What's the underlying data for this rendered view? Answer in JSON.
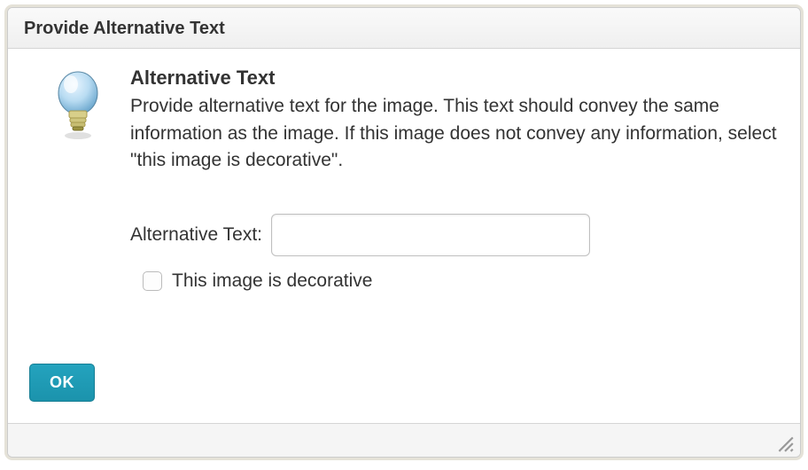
{
  "dialog": {
    "title": "Provide Alternative Text"
  },
  "section": {
    "heading": "Alternative Text",
    "description": "Provide alternative text for the image. This text should convey the same information as the image. If this image does not convey any information, select \"this image is decorative\"."
  },
  "form": {
    "alt_label": "Alternative Text:",
    "alt_value": "",
    "decorative_label": "This image is decorative"
  },
  "buttons": {
    "ok": "OK"
  }
}
